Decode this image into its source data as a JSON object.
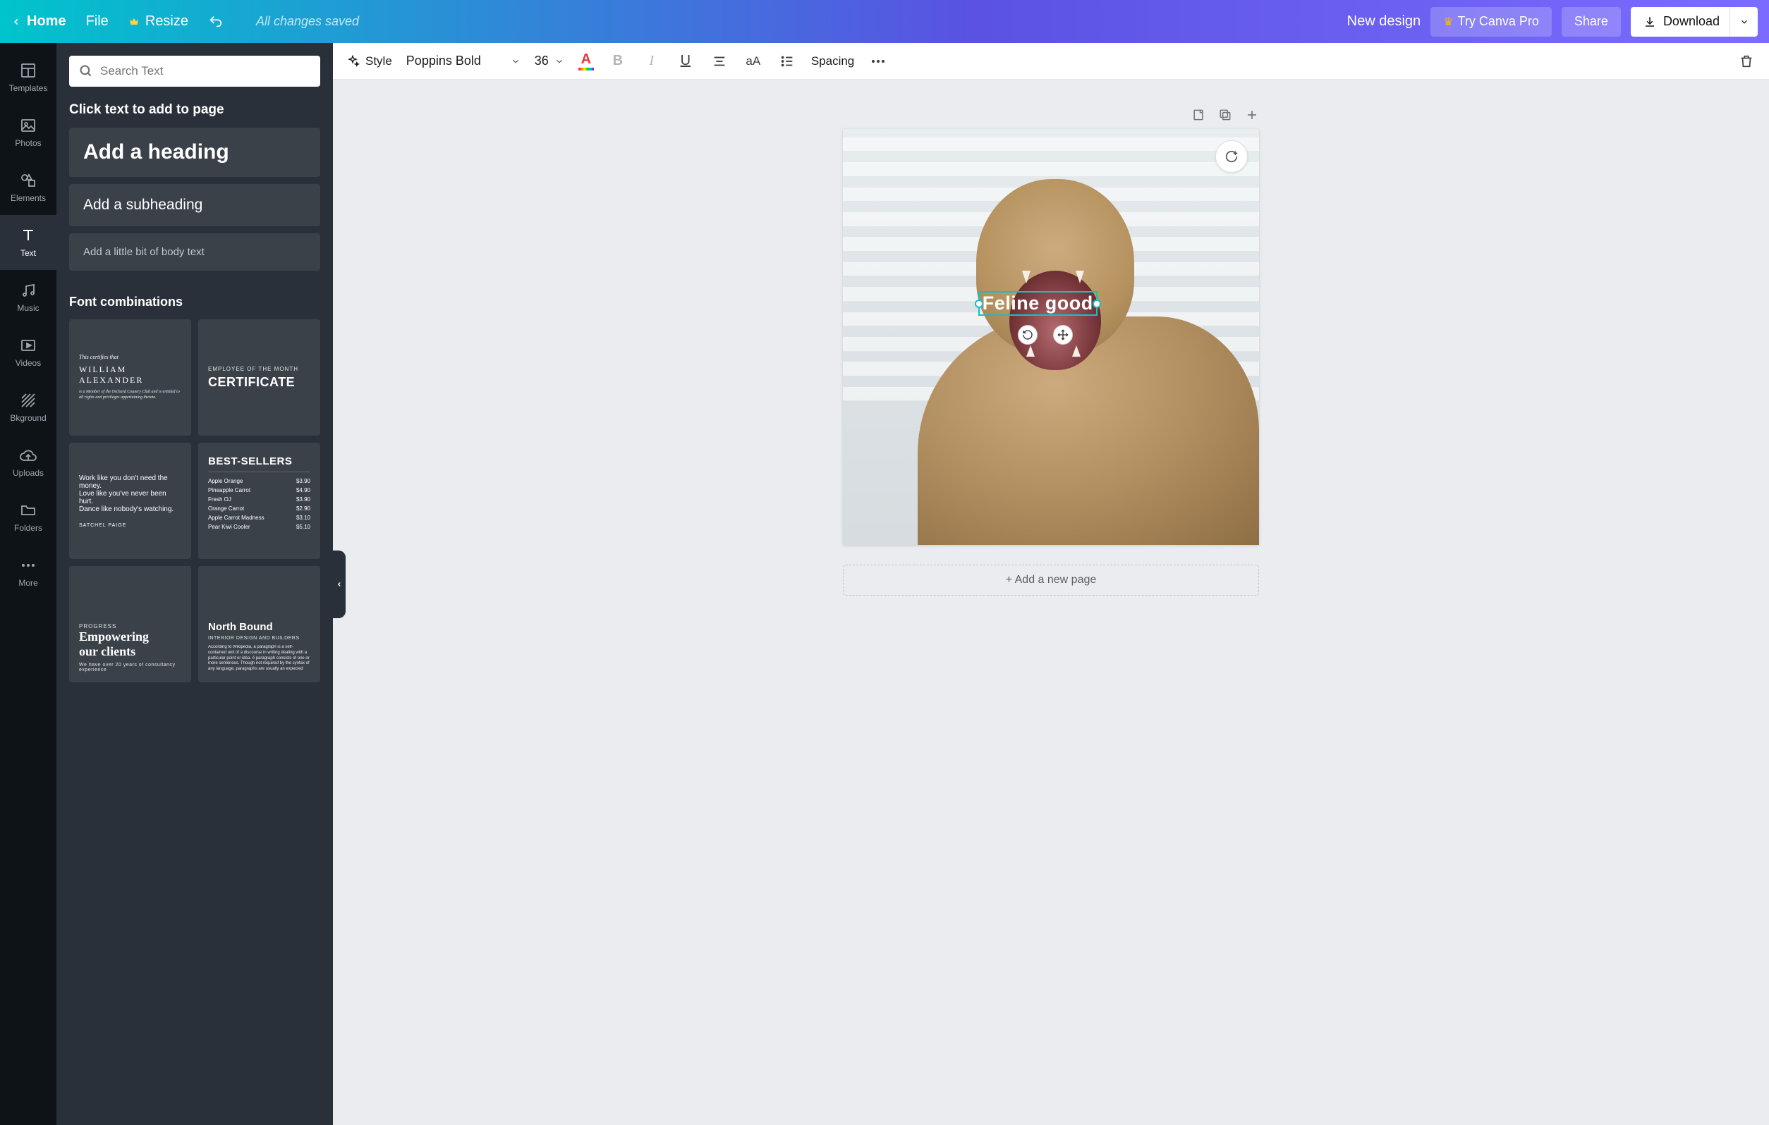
{
  "header": {
    "home": "Home",
    "file": "File",
    "resize": "Resize",
    "saved": "All changes saved",
    "new_design": "New design",
    "try_pro": "Try Canva Pro",
    "share": "Share",
    "download": "Download"
  },
  "vnav": {
    "templates": "Templates",
    "photos": "Photos",
    "elements": "Elements",
    "text": "Text",
    "music": "Music",
    "videos": "Videos",
    "bkground": "Bkground",
    "uploads": "Uploads",
    "folders": "Folders",
    "more": "More"
  },
  "panel": {
    "search_placeholder": "Search Text",
    "click_hint": "Click text to add to page",
    "add_heading": "Add a heading",
    "add_subheading": "Add a subheading",
    "add_body": "Add a little bit of body text",
    "font_combos": "Font combinations",
    "tiles": {
      "t1": {
        "line1": "This certifies that",
        "line2": "WILLIAM ALEXANDER",
        "line3": "is a Member of the Orchard Country Club and is entitled to all rights and privileges appertaining thereto."
      },
      "t2": {
        "line1": "EMPLOYEE OF THE MONTH",
        "line2": "CERTIFICATE"
      },
      "t3": {
        "line1": "Work like you don't need the money.",
        "line2": "Love like you've never been hurt.",
        "line3": "Dance like nobody's watching.",
        "attr": "SATCHEL PAIGE"
      },
      "t4": {
        "title": "BEST-SELLERS",
        "rows": [
          {
            "n": "Apple Orange",
            "p": "$3.90"
          },
          {
            "n": "Pineapple Carrot",
            "p": "$4.90"
          },
          {
            "n": "Fresh OJ",
            "p": "$3.90"
          },
          {
            "n": "Orange Carrot",
            "p": "$2.90"
          },
          {
            "n": "Apple Carrot Madness",
            "p": "$3.10"
          },
          {
            "n": "Pear Kiwi Cooler",
            "p": "$5.10"
          }
        ]
      },
      "t5": {
        "eyebrow": "PROGRESS",
        "line1": "Empowering",
        "line2": "our clients",
        "sub": "We have over 20 years of consultancy experience"
      },
      "t6": {
        "title": "North Bound",
        "eyebrow": "INTERIOR DESIGN AND BUILDERS",
        "para": "According to Wikipedia, a paragraph is a self-contained unit of a discourse in writing dealing with a particular point or idea. A paragraph consists of one or more sentences. Though not required by the syntax of any language, paragraphs are usually an expected"
      }
    }
  },
  "toolbar": {
    "style": "Style",
    "font": "Poppins Bold",
    "size": "36",
    "spacing": "Spacing"
  },
  "canvas": {
    "text_value": "Feline good",
    "add_page": "+ Add a new page"
  }
}
